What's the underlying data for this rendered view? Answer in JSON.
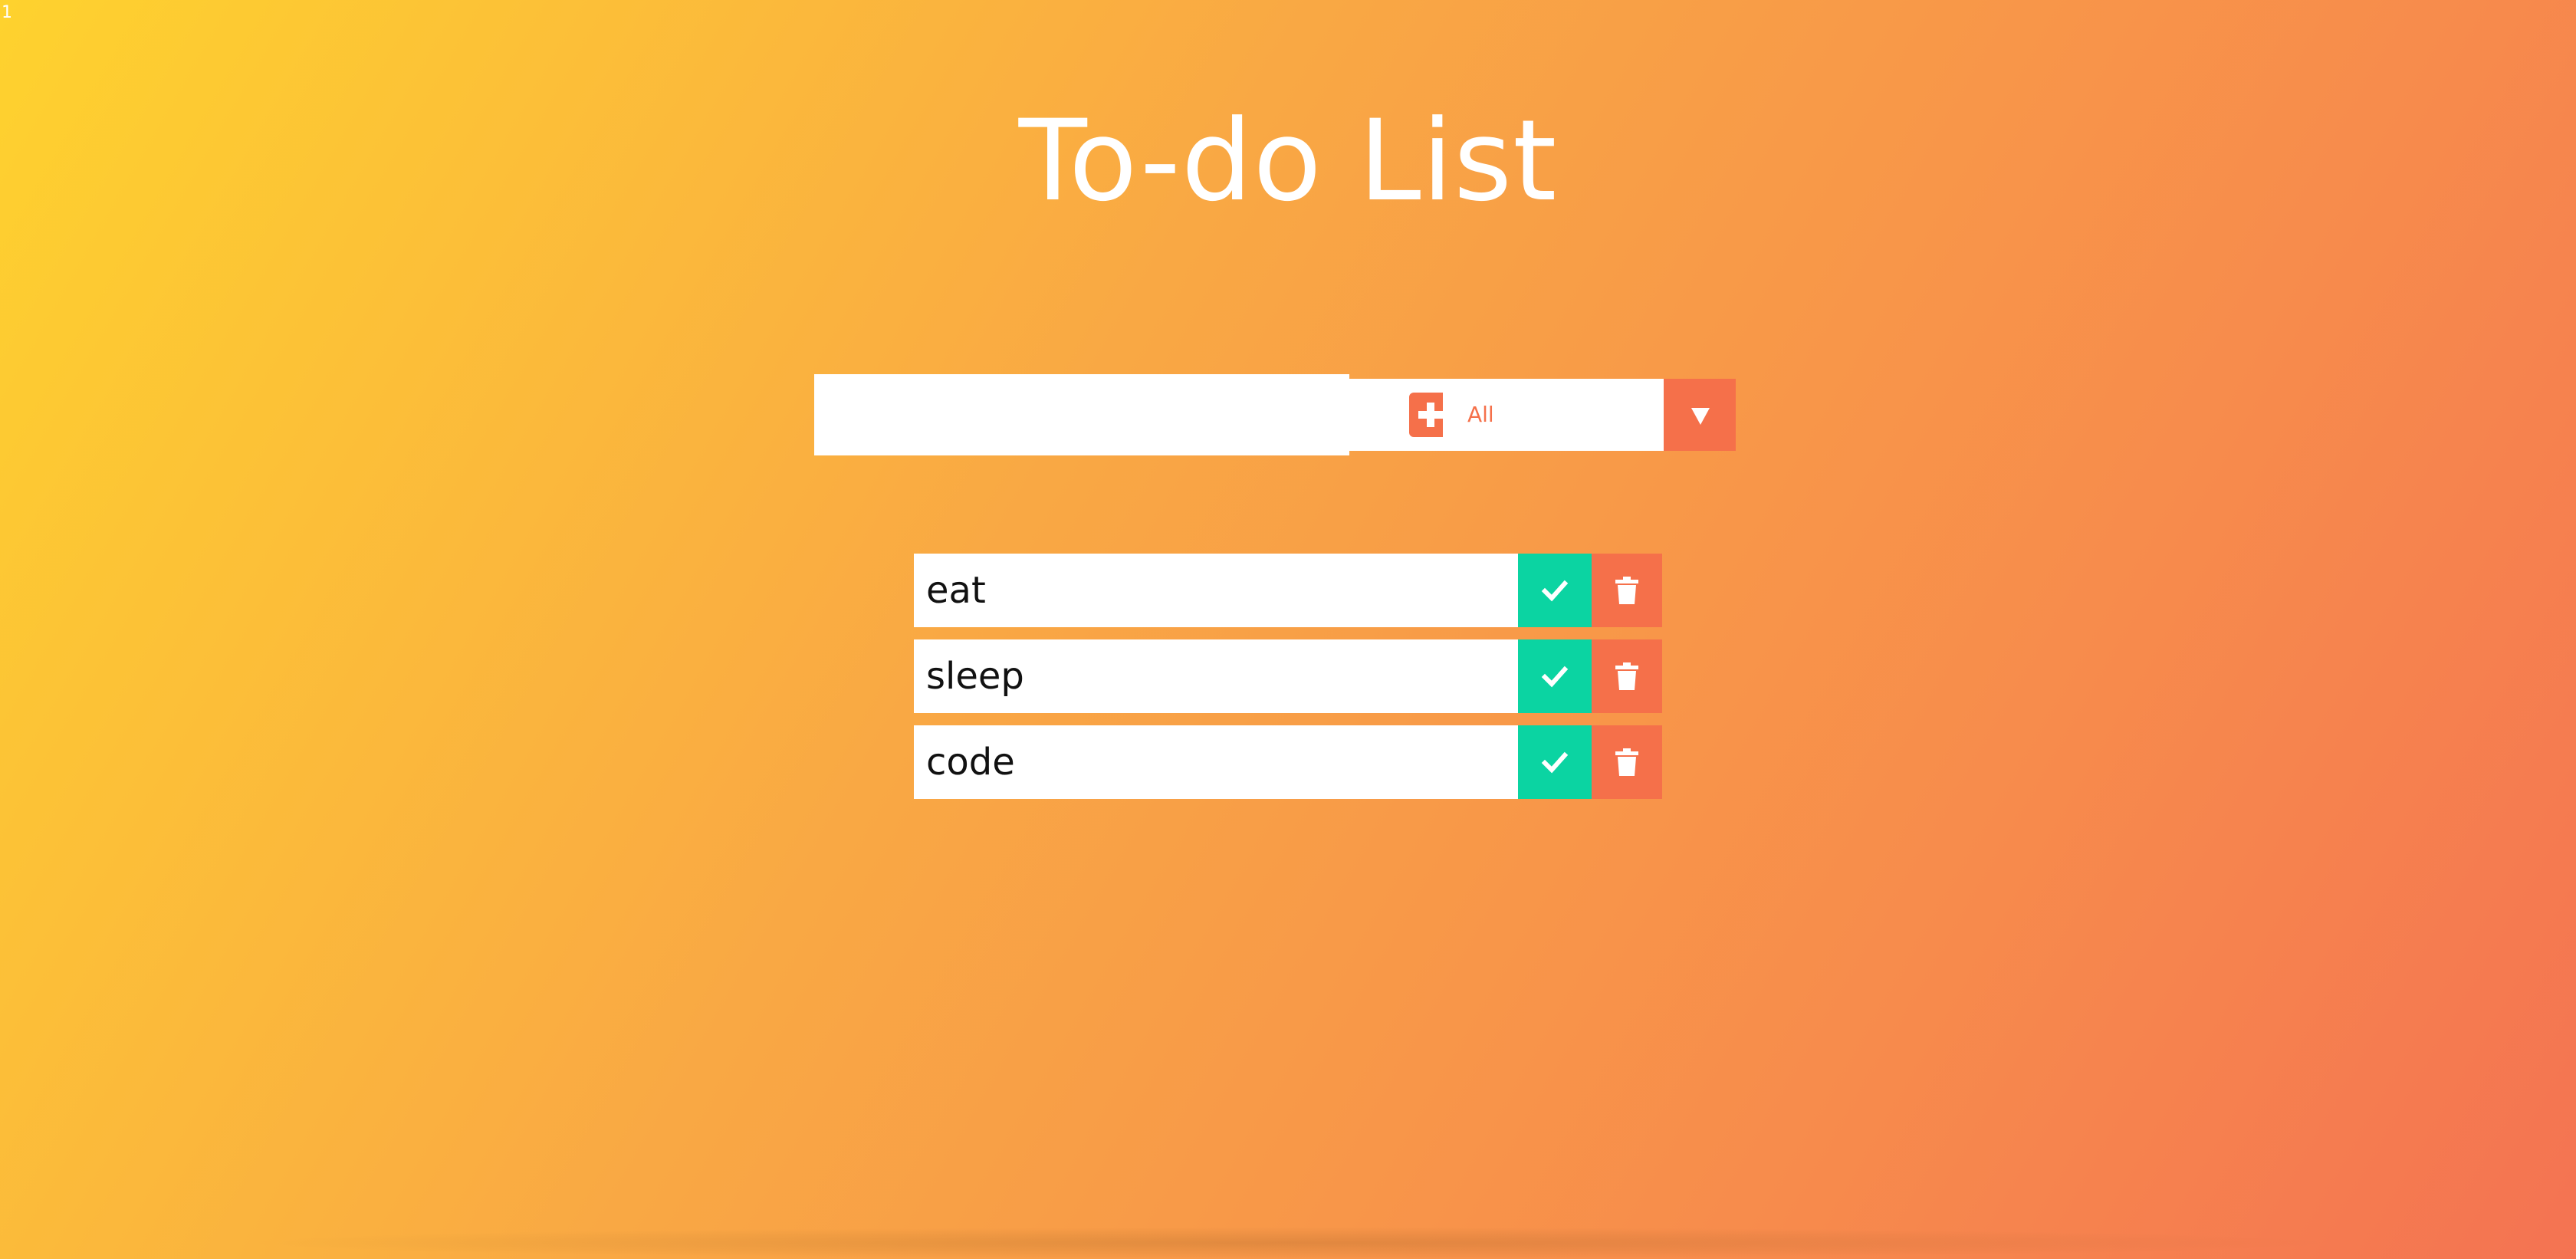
{
  "corner_mark": "1",
  "title": "To-do List",
  "add_form": {
    "input_value": "",
    "add_icon": "plus-square-icon"
  },
  "filter": {
    "selected": "All",
    "arrow_icon": "caret-down-icon"
  },
  "todos": [
    {
      "text": "eat"
    },
    {
      "text": "sleep"
    },
    {
      "text": "code"
    }
  ],
  "icons": {
    "complete": "check-icon",
    "delete": "trash-icon"
  },
  "colors": {
    "accent": "#f5704a",
    "complete": "#0bd4a2",
    "gradient_start": "#fed22e",
    "gradient_end": "#f47352"
  }
}
